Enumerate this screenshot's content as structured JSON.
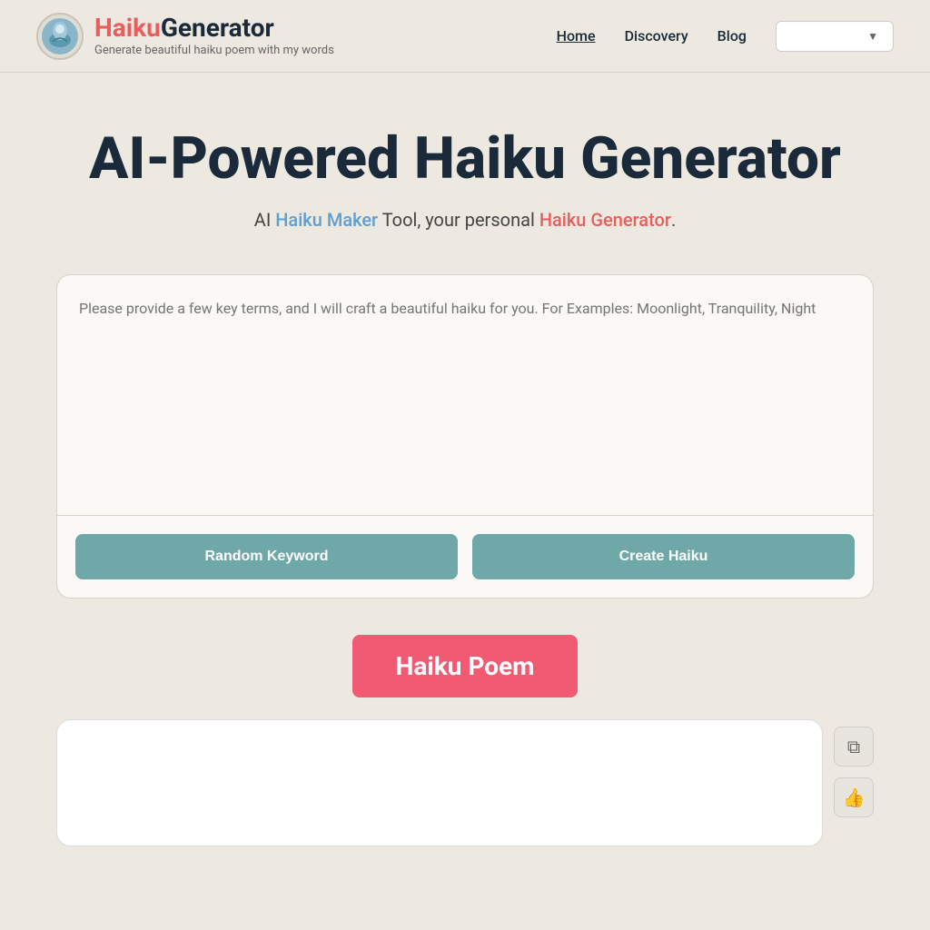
{
  "header": {
    "logo": {
      "haiku_part": "Haiku",
      "generator_part": "Generator",
      "subtitle": "Generate beautiful haiku poem with my words"
    },
    "nav": {
      "home_label": "Home",
      "discovery_label": "Discovery",
      "blog_label": "Blog",
      "dropdown_placeholder": ""
    }
  },
  "hero": {
    "title": "AI-Powered Haiku Generator",
    "subtitle_prefix": "AI ",
    "subtitle_link1": "Haiku Maker",
    "subtitle_middle": " Tool, your personal ",
    "subtitle_link2": "Haiku Generator",
    "subtitle_suffix": "."
  },
  "input_section": {
    "textarea_placeholder": "Please provide a few key terms, and I will craft a beautiful haiku for you. For Examples: Moonlight, Tranquility, Night",
    "random_keyword_label": "Random Keyword",
    "create_haiku_label": "Create Haiku"
  },
  "output_section": {
    "banner_label": "Haiku Poem",
    "copy_icon": "⧉",
    "like_icon": "👍"
  }
}
